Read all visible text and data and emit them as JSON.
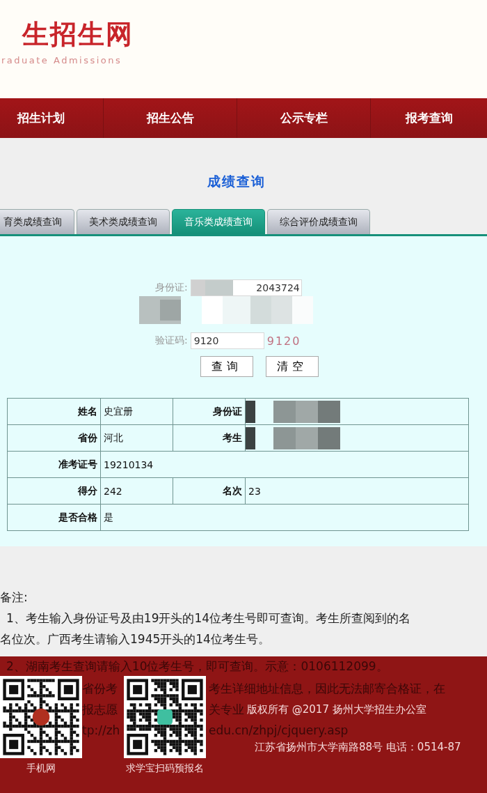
{
  "header": {
    "logo_title": "生招生网",
    "logo_subtitle": "raduate Admissions"
  },
  "nav": [
    {
      "label": "招生计划"
    },
    {
      "label": "招生公告"
    },
    {
      "label": "公示专栏"
    },
    {
      "label": "报考查询"
    }
  ],
  "page_title": "成绩查询",
  "tabs": [
    {
      "label": "育类成绩查询",
      "selected": false
    },
    {
      "label": "美术类成绩查询",
      "selected": false
    },
    {
      "label": "音乐类成绩查询",
      "selected": true
    },
    {
      "label": "综合评价成绩查询",
      "selected": false
    }
  ],
  "form": {
    "id_label": "身份证:",
    "id_value": "2043724",
    "captcha_label": "验证码:",
    "captcha_value": "9120",
    "captcha_image": "9120",
    "buttons": [
      "查询",
      "清空"
    ]
  },
  "result_table": {
    "rows": [
      [
        {
          "label": "姓名",
          "kind": "text",
          "value": "史宜册"
        },
        {
          "label": "身份证",
          "kind": "redacted"
        }
      ],
      [
        {
          "label": "省份",
          "kind": "text",
          "value": "河北"
        },
        {
          "label": "考生",
          "kind": "redacted"
        }
      ],
      [
        {
          "label": "准考证号",
          "kind": "text",
          "value": "19210134"
        }
      ],
      [
        {
          "label": "得分",
          "kind": "text",
          "value": "242"
        },
        {
          "label": "名次",
          "kind": "text",
          "value": "23"
        }
      ],
      [
        {
          "label": "是否合格",
          "kind": "text",
          "value": "是"
        }
      ]
    ]
  },
  "notes": {
    "heading": "备注:",
    "lines": [
      "1、考生输入身份证号及由19开头的14位考生号即可查询。考生所查阅到的名",
      "名位次。广西考生请输入1945开头的14位考生号。"
    ]
  },
  "footer": {
    "note_line": "2、湖南考生查询请输入10位考生号，即可查询。示意：0106112099。",
    "left_fragments": [
      "省份考",
      "报志愿",
      "tp://zh"
    ],
    "right_fragments": [
      "考生详细地址信息，因此无法邮寄合格证，在",
      "关专业",
      "edu.cn/zhpj/cjquery.asp"
    ],
    "qr_codes": [
      {
        "caption": "手机网"
      },
      {
        "caption": "求学宝扫码预报名"
      }
    ],
    "copyright": "版权所有 @2017 扬州大学招生办公室",
    "address": "江苏省扬州市大学南路88号 电话：0514-87"
  }
}
